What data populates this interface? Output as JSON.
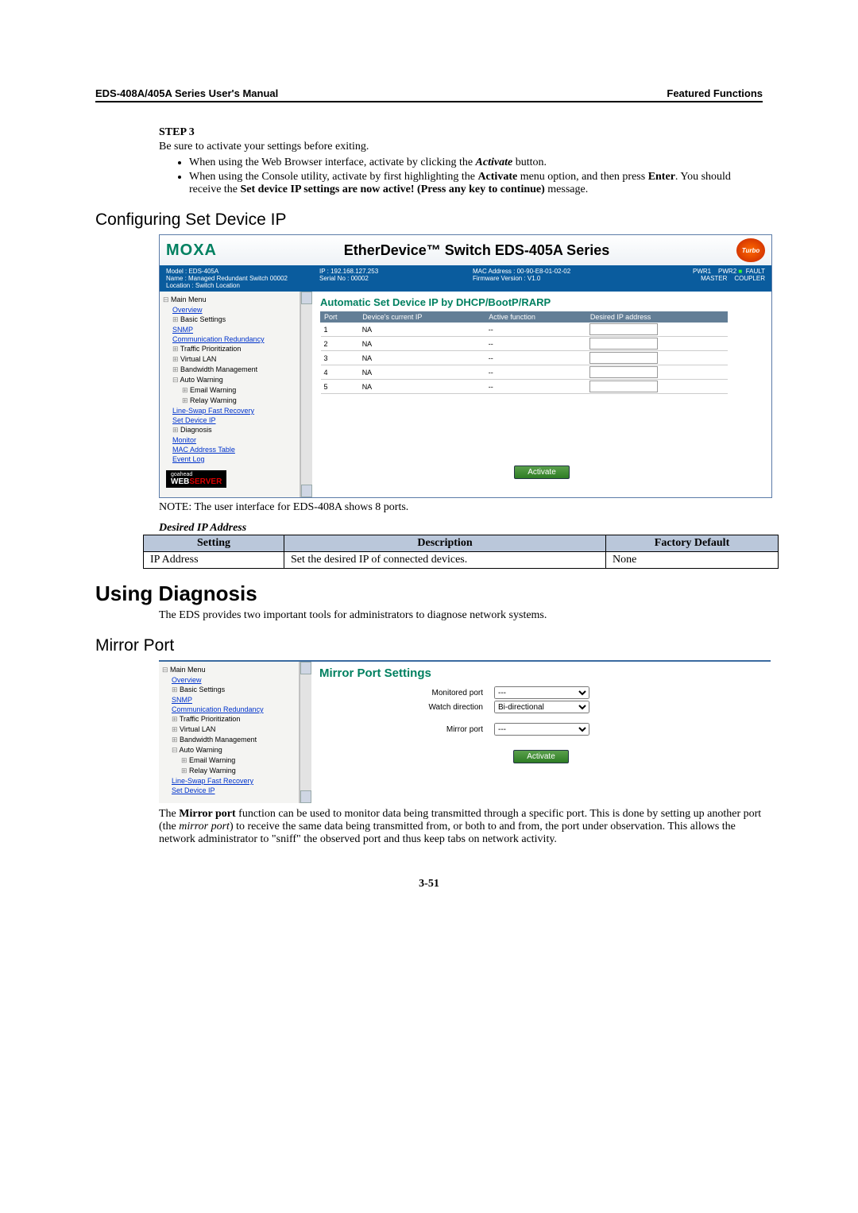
{
  "header": {
    "left": "EDS-408A/405A Series User's Manual",
    "right": "Featured Functions"
  },
  "step": {
    "label": "STEP 3",
    "intro": "Be sure to activate your settings before exiting.",
    "b1_a": "When using the Web Browser interface, activate by clicking the ",
    "b1_b": "Activate",
    "b1_c": " button.",
    "b2_a": "When using the Console utility, activate by first highlighting the ",
    "b2_b": "Activate",
    "b2_c": " menu option, and then press ",
    "b2_d": "Enter",
    "b2_e": ". You should receive the ",
    "b2_f": "Set device IP settings are now active! (Press any key to continue)",
    "b2_g": " message."
  },
  "h_config": "Configuring Set Device IP",
  "ss1": {
    "moxa": "MOXA",
    "title": "EtherDevice™ Switch EDS-405A Series",
    "turbo": "Turbo",
    "info": {
      "model": "Model : EDS-405A",
      "name": "Name : Managed Redundant Switch 00002",
      "location": "Location : Switch Location",
      "ip": "IP : 192.168.127.253",
      "serial": "Serial No : 00002",
      "mac": "MAC Address : 00-90-E8-01-02-02",
      "fw": "Firmware Version : V1.0",
      "pwr1": "PWR1",
      "master": "MASTER",
      "pwr2": "PWR2",
      "coupler": "COUPLER",
      "fault": "FAULT"
    },
    "nav": {
      "main": "Main Menu",
      "overview": "Overview",
      "basic": "Basic Settings",
      "snmp": "SNMP",
      "comm": "Communication Redundancy",
      "traffic": "Traffic Prioritization",
      "vlan": "Virtual LAN",
      "bw": "Bandwidth Management",
      "auto": "Auto Warning",
      "email": "Email Warning",
      "relay": "Relay Warning",
      "line": "Line-Swap Fast Recovery",
      "sdip": "Set Device IP",
      "diag": "Diagnosis",
      "mon": "Monitor",
      "mact": "MAC Address Table",
      "evl": "Event Log"
    },
    "ctitle": "Automatic Set Device IP by DHCP/BootP/RARP",
    "th": {
      "port": "Port",
      "cur": "Device's current IP",
      "act": "Active function",
      "des": "Desired IP address"
    },
    "rows": [
      {
        "p": "1",
        "c": "NA",
        "a": "--"
      },
      {
        "p": "2",
        "c": "NA",
        "a": "--"
      },
      {
        "p": "3",
        "c": "NA",
        "a": "--"
      },
      {
        "p": "4",
        "c": "NA",
        "a": "--"
      },
      {
        "p": "5",
        "c": "NA",
        "a": "--"
      }
    ],
    "activate": "Activate",
    "goahead": "goahead",
    "webserver_a": "WEB",
    "webserver_b": "SERVER"
  },
  "note": "NOTE: The user interface for EDS-408A shows 8 ports.",
  "desired": "Desired IP Address",
  "tbl": {
    "h1": "Setting",
    "h2": "Description",
    "h3": "Factory Default",
    "r1": "IP Address",
    "r2": "Set the desired IP of connected devices.",
    "r3": "None"
  },
  "h_diag": "Using Diagnosis",
  "diag_intro": "The EDS provides two important tools for administrators to diagnose network systems.",
  "h_mirror": "Mirror Port",
  "ss2": {
    "title": "Mirror Port Settings",
    "monitored": "Monitored port",
    "watch": "Watch direction",
    "watch_val": "Bi-directional",
    "mirror": "Mirror port",
    "dash": "---",
    "activate": "Activate"
  },
  "para_a": "The ",
  "para_b": "Mirror port",
  "para_c": " function can be used to monitor data being transmitted through a specific port. This is done by setting up another port (the ",
  "para_d": "mirror port",
  "para_e": ") to receive the same data being transmitted from, or both to and from, the port under observation. This allows the network administrator to \"sniff\" the observed port and thus keep tabs on network activity.",
  "pagenum": "3-51"
}
